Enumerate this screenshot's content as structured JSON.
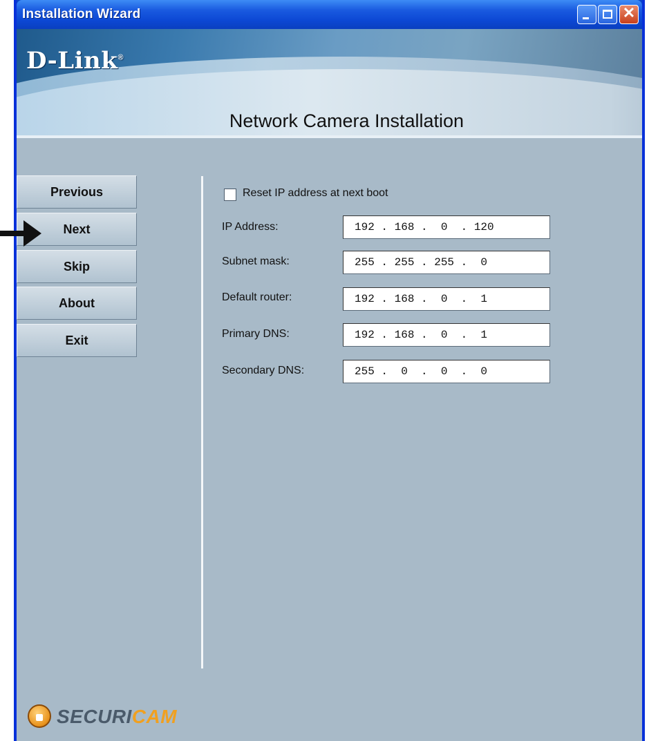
{
  "window": {
    "title": "Installation Wizard"
  },
  "banner": {
    "logo": "D-Link",
    "logo_mark": "®",
    "title": "Network Camera Installation"
  },
  "nav": {
    "previous": "Previous",
    "next": "Next",
    "skip": "Skip",
    "about": "About",
    "exit": "Exit"
  },
  "form": {
    "reset_label": "Reset IP address at next boot",
    "reset_checked": false,
    "fields": [
      {
        "label": "IP Address:",
        "value": "192 . 168 .  0  . 120"
      },
      {
        "label": "Subnet mask:",
        "value": "255 . 255 . 255 .  0"
      },
      {
        "label": "Default router:",
        "value": "192 . 168 .  0  .  1"
      },
      {
        "label": "Primary DNS:",
        "value": "192 . 168 .  0  .  1"
      },
      {
        "label": "Secondary DNS:",
        "value": "255 .  0  .  0  .  0"
      }
    ]
  },
  "footer": {
    "brand_part1": "SECURI",
    "brand_part2": "CAM"
  },
  "colors": {
    "titlebar": "#0a44c8",
    "content_bg": "#a8bac8",
    "brand_orange": "#f0a020"
  },
  "icons": [
    "minimize-icon",
    "maximize-icon",
    "close-icon",
    "pointer-arrow-icon",
    "lock-icon"
  ]
}
